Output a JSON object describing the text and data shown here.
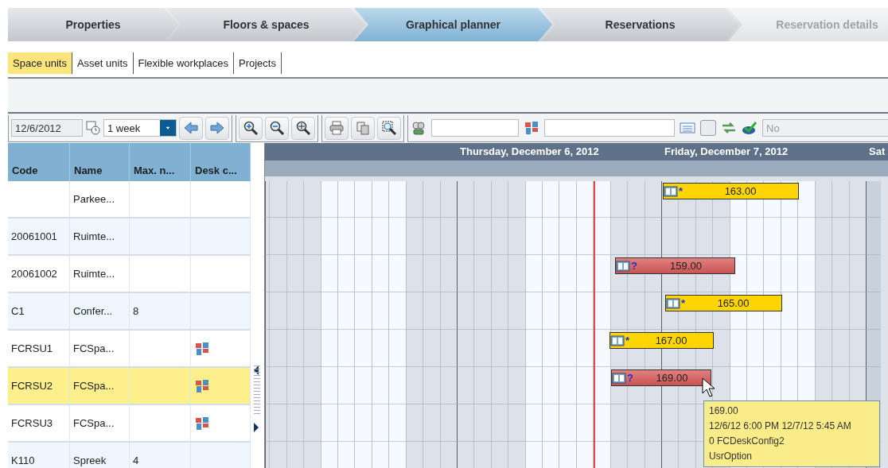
{
  "steps": [
    {
      "label": "Properties",
      "selected": false,
      "disabled": false
    },
    {
      "label": "Floors & spaces",
      "selected": false,
      "disabled": false
    },
    {
      "label": "Graphical planner",
      "selected": true,
      "disabled": false
    },
    {
      "label": "Reservations",
      "selected": false,
      "disabled": false
    },
    {
      "label": "Reservation details",
      "selected": false,
      "disabled": true
    }
  ],
  "tabs": [
    {
      "label": "Space units",
      "selected": true
    },
    {
      "label": "Asset units",
      "selected": false
    },
    {
      "label": "Flexible workplaces",
      "selected": false
    },
    {
      "label": "Projects",
      "selected": false
    }
  ],
  "toolbar": {
    "date": "12/6/2012",
    "period": "1 week",
    "filter_checked": false,
    "option_value": "No"
  },
  "table": {
    "columns": [
      "Code",
      "Name",
      "Max. n...",
      "Desk c..."
    ],
    "rows": [
      {
        "code": "",
        "name": "Parkee...",
        "max": "",
        "desk_config": false,
        "selected": false,
        "reservation": {
          "kind": "confirmed",
          "marker": "*",
          "label": "163.00"
        }
      },
      {
        "code": "20061001",
        "name": "Ruimte...",
        "max": "",
        "desk_config": false,
        "selected": false
      },
      {
        "code": "20061002",
        "name": "Ruimte...",
        "max": "",
        "desk_config": false,
        "selected": false,
        "reservation": {
          "kind": "option",
          "marker": "?",
          "label": "159.00"
        }
      },
      {
        "code": "C1",
        "name": "Confer...",
        "max": "8",
        "desk_config": false,
        "selected": false,
        "reservation": {
          "kind": "confirmed",
          "marker": "*",
          "label": "165.00"
        }
      },
      {
        "code": "FCRSU1",
        "name": "FCSpa...",
        "max": "",
        "desk_config": true,
        "selected": false,
        "reservation": {
          "kind": "confirmed",
          "marker": "*",
          "label": "167.00"
        }
      },
      {
        "code": "FCRSU2",
        "name": "FCSpa...",
        "max": "",
        "desk_config": true,
        "selected": true,
        "reservation": {
          "kind": "option",
          "marker": "?",
          "label": "169.00"
        }
      },
      {
        "code": "FCRSU3",
        "name": "FCSpa...",
        "max": "",
        "desk_config": true,
        "selected": false
      },
      {
        "code": "K110",
        "name": "Spreek",
        "max": "4",
        "desk_config": false,
        "selected": false
      }
    ]
  },
  "gantt": {
    "days": [
      "Thursday, December 6, 2012",
      "Friday, December 7, 2012",
      "Sat"
    ]
  },
  "tooltip": {
    "lines": [
      "169.00",
      "12/6/12 6:00 PM 12/7/12 5:45 AM",
      "0 FCDeskConfig2",
      "UsrOption"
    ]
  }
}
